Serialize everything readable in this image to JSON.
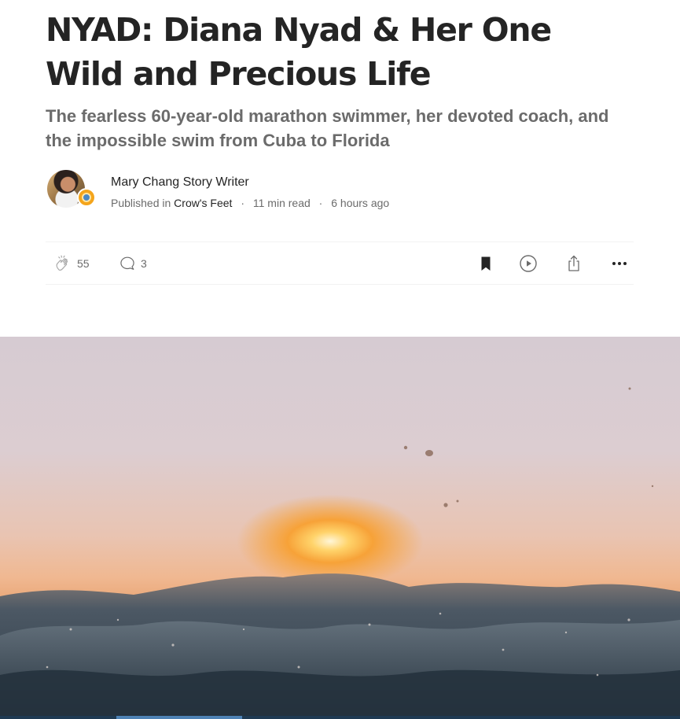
{
  "article": {
    "title": "NYAD: Diana Nyad & Her One Wild and Precious Life",
    "subtitle": "The fearless 60-year-old marathon swimmer, her devoted coach, and the impossible swim from Cuba to Florida"
  },
  "byline": {
    "author": "Mary Chang Story Writer",
    "published_prefix": "Published in",
    "publication": "Crow's Feet",
    "separator": "·",
    "read_time": "11 min read",
    "posted": "6 hours ago"
  },
  "actions": {
    "claps": "55",
    "responses": "3"
  },
  "icons": [
    "clap-icon",
    "comment-icon",
    "bookmark-icon",
    "play-icon",
    "share-icon",
    "more-icon"
  ],
  "colors": {
    "text": "#242424",
    "muted": "#6b6b6b",
    "divider": "#f2f2f2",
    "publication_badge": "#f4a51c"
  }
}
